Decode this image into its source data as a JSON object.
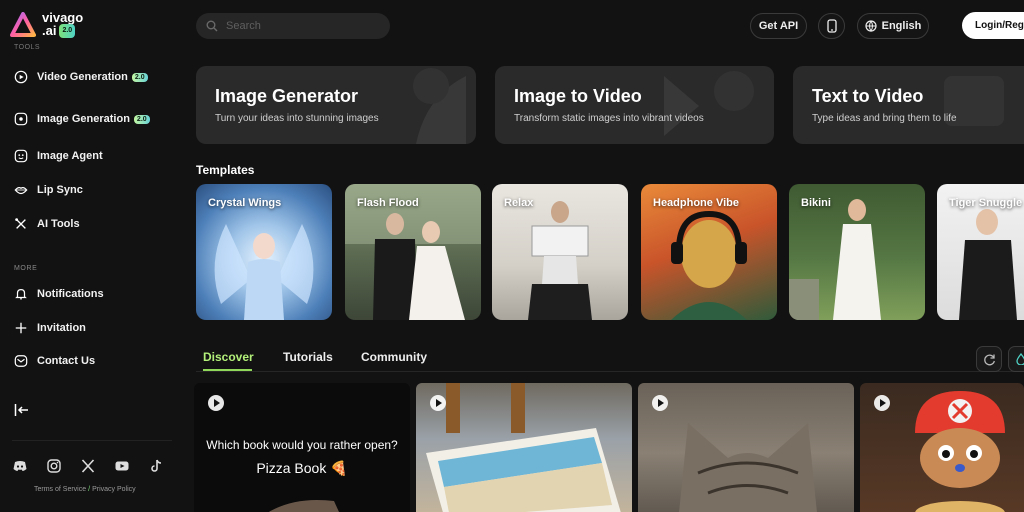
{
  "brand": {
    "name": "vivago",
    "sub": ".ai",
    "version": "2.0"
  },
  "sidebar": {
    "tools_label_cut": "TOOLS",
    "items": [
      {
        "label": "Video Generation",
        "badge": "2.0",
        "icon": "play-circle-icon"
      },
      {
        "label": "Image Generation",
        "badge": "2.0",
        "icon": "image-spark-icon"
      },
      {
        "label": "Image Agent",
        "icon": "agent-icon"
      },
      {
        "label": "Lip Sync",
        "icon": "lips-icon"
      },
      {
        "label": "AI Tools",
        "icon": "tools-icon"
      }
    ],
    "more_label": "MORE",
    "more_items": [
      {
        "label": "Notifications",
        "icon": "bell-icon"
      },
      {
        "label": "Invitation",
        "icon": "plus-icon"
      },
      {
        "label": "Contact Us",
        "icon": "mail-icon"
      }
    ],
    "legal": {
      "terms": "Terms of Service",
      "sep": "/",
      "privacy": "Privacy Policy"
    },
    "socials": [
      "discord-icon",
      "instagram-icon",
      "x-icon",
      "youtube-icon",
      "tiktok-icon"
    ]
  },
  "topbar": {
    "search_placeholder": "Search",
    "get_api": "Get API",
    "language": "English",
    "login": "Login/Register"
  },
  "features": [
    {
      "title": "Image Generator",
      "desc": "Turn your ideas into stunning images"
    },
    {
      "title": "Image to Video",
      "desc": "Transform static images into vibrant videos"
    },
    {
      "title": "Text to Video",
      "desc": "Type ideas and bring them to life"
    }
  ],
  "templates": {
    "title": "Templates",
    "items": [
      {
        "label": "Crystal Wings"
      },
      {
        "label": "Flash Flood"
      },
      {
        "label": "Relax"
      },
      {
        "label": "Headphone Vibe"
      },
      {
        "label": "Bikini"
      },
      {
        "label": "Tiger Snuggle"
      }
    ]
  },
  "tabs": {
    "discover": "Discover",
    "tutorials": "Tutorials",
    "community": "Community"
  },
  "feed": {
    "book_question": "Which book would you rather open?",
    "book_title": "Pizza Book 🍕"
  },
  "colors": {
    "accent": "#8fd85a",
    "bg": "#121212",
    "card": "#2a2a2a"
  }
}
